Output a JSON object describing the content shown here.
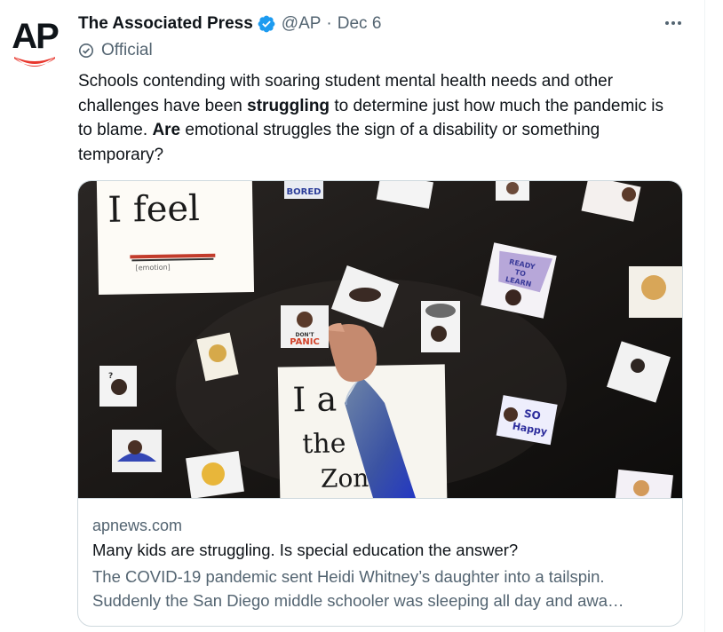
{
  "author": {
    "name": "The Associated Press",
    "handle": "@AP",
    "separator": "·",
    "time": "Dec 6",
    "official_label": "Official",
    "avatar_text": "AP"
  },
  "tweet": {
    "segments": [
      {
        "text": "Schools contending with soaring student mental health needs and other challenges have been ",
        "bold": false
      },
      {
        "text": "struggling",
        "bold": true
      },
      {
        "text": " to determine just how much the pandemic is to blame. ",
        "bold": false
      },
      {
        "text": "Are",
        "bold": true
      },
      {
        "text": " emotional struggles the sign of a disability or something temporary?",
        "bold": false
      }
    ]
  },
  "card": {
    "domain": "apnews.com",
    "title": "Many kids are struggling. Is special education the answer?",
    "description": "The COVID-19 pandemic sent Heidi Whitney’s daughter into a tailspin. Suddenly the San Diego middle schooler was sleeping all day and awa…",
    "image_text": {
      "poster1_line1": "I feel",
      "poster1_caption": "[emotion]",
      "poster2_line1": "I a",
      "poster2_line2": "the",
      "poster2_line3": "Zon",
      "sticker_bored": "BORED",
      "sticker_panic_1": "DON'T",
      "sticker_panic_2": "PANIC",
      "sticker_ready_1": "READY",
      "sticker_ready_2": "TO",
      "sticker_ready_3": "LEARN",
      "sticker_happy_1": "SO",
      "sticker_happy_2": "Happy",
      "sticker_question": "?"
    }
  },
  "colors": {
    "text_primary": "#0f1419",
    "text_secondary": "#536471",
    "verified_blue": "#1d9bf0",
    "ap_red": "#e8362c",
    "border": "#cfd9de"
  },
  "icons": {
    "verified": "verified-badge-icon",
    "official": "official-check-icon",
    "more": "more-options-icon"
  }
}
